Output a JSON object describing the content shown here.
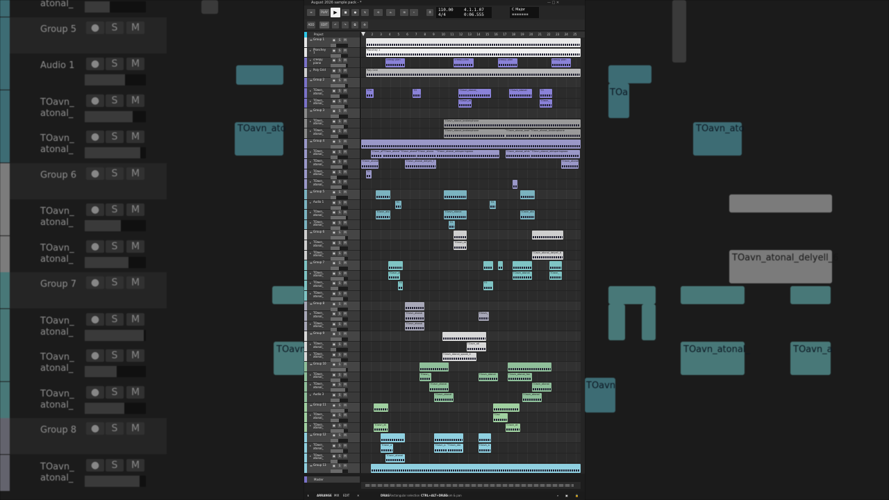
{
  "window": {
    "title": "August 2026 sample pack - *",
    "transport": {
      "tempo": "110.00",
      "time_signature": "4/4",
      "position_bars": "4.1.1.07",
      "position_time": "0:06.555",
      "key": "C Major",
      "play_label": "PLAY"
    },
    "toolbar": {
      "buttons": [
        "ADD",
        "EDIT"
      ]
    },
    "project_label": "Project",
    "ruler": [
      "1",
      "2",
      "3",
      "4",
      "5",
      "6",
      "7",
      "8",
      "9",
      "10",
      "11",
      "12",
      "13",
      "14",
      "15",
      "16",
      "17",
      "18",
      "19",
      "20",
      "21",
      "22",
      "23",
      "24",
      "25"
    ],
    "master_label": "Master",
    "status": {
      "tabs": [
        "ARRANGE",
        "MIX",
        "EDIT"
      ],
      "hint1_key": "DRAG",
      "hint1_text": "Rectangular selection",
      "hint2_key": "CTRL+ALT+DRAG",
      "hint2_text": "Zoom & pan"
    }
  },
  "tracks": [
    {
      "name": "Group 1",
      "kind": "group",
      "color": "#e6e6e6"
    },
    {
      "name": "Plonchey\n1",
      "kind": "track",
      "color": "#e6e6e6"
    },
    {
      "name": "creepy\npiano",
      "kind": "track",
      "color": "#7a72c8"
    },
    {
      "name": "Poly Grid",
      "kind": "track",
      "color": "#cfcfcf"
    },
    {
      "name": "Group 2",
      "kind": "group",
      "color": "#7a72c8"
    },
    {
      "name": "TOavn_\natonal_",
      "kind": "track",
      "color": "#7a72c8"
    },
    {
      "name": "TOavn_\natonal_",
      "kind": "track",
      "color": "#7a72c8"
    },
    {
      "name": "Group 3",
      "kind": "group",
      "color": "#8a8a8a"
    },
    {
      "name": "TOavn_\natonal_",
      "kind": "track",
      "color": "#8a8a8a"
    },
    {
      "name": "TOavn_\natonal_",
      "kind": "track",
      "color": "#8a8a8a"
    },
    {
      "name": "Group 4",
      "kind": "group",
      "color": "#9a98c8"
    },
    {
      "name": "TOavn_\natonal_",
      "kind": "track",
      "color": "#9a98c8"
    },
    {
      "name": "TOavn_\natonal_",
      "kind": "track",
      "color": "#9a98c8"
    },
    {
      "name": "TOavn_\natonal_",
      "kind": "track",
      "color": "#9a98c8"
    },
    {
      "name": "TOavn_\natonal_",
      "kind": "track",
      "color": "#9a98c8"
    },
    {
      "name": "Group 5",
      "kind": "group",
      "color": "#7bb3c0"
    },
    {
      "name": "Audio 1",
      "kind": "track",
      "color": "#7bb3c0"
    },
    {
      "name": "TOavn_\natonal_",
      "kind": "track",
      "color": "#7bb3c0"
    },
    {
      "name": "TOavn_\natonal_",
      "kind": "track",
      "color": "#7bb3c0"
    },
    {
      "name": "Group 6",
      "kind": "group",
      "color": "#cfcfcf"
    },
    {
      "name": "TOavn_\natonal_",
      "kind": "track",
      "color": "#cfcfcf"
    },
    {
      "name": "TOavn_\natonal_",
      "kind": "track",
      "color": "#cfcfcf"
    },
    {
      "name": "Group 7",
      "kind": "group",
      "color": "#7fc4c4"
    },
    {
      "name": "TOavn_\natonal_",
      "kind": "track",
      "color": "#7fc4c4"
    },
    {
      "name": "TOavn_\natonal_",
      "kind": "track",
      "color": "#7fc4c4"
    },
    {
      "name": "TOavn_\natonal_",
      "kind": "track",
      "color": "#7fc4c4"
    },
    {
      "name": "Group 8",
      "kind": "group",
      "color": "#a8a8b8"
    },
    {
      "name": "TOavn_\natonal_",
      "kind": "track",
      "color": "#a8a8b8"
    },
    {
      "name": "TOavn_\natonal_",
      "kind": "track",
      "color": "#a8a8b8"
    },
    {
      "name": "Group 9",
      "kind": "group",
      "color": "#d8d8d8"
    },
    {
      "name": "TOavn_\natonal_",
      "kind": "track",
      "color": "#d8d8d8"
    },
    {
      "name": "TOavn_\natonal_",
      "kind": "track",
      "color": "#d8d8d8"
    },
    {
      "name": "Group 10",
      "kind": "group",
      "color": "#8fbf9a"
    },
    {
      "name": "TOavn_\natonal_",
      "kind": "track",
      "color": "#8fbf9a"
    },
    {
      "name": "TOavn_\natonal_",
      "kind": "track",
      "color": "#8fbf9a"
    },
    {
      "name": "Audio 3",
      "kind": "track",
      "color": "#8fbf9a"
    },
    {
      "name": "Group 11",
      "kind": "group",
      "color": "#a0d0a0"
    },
    {
      "name": "TOavn_\natonal_",
      "kind": "track",
      "color": "#a0d0a0"
    },
    {
      "name": "TOavn_\natonal_",
      "kind": "track",
      "color": "#a0d0a0"
    },
    {
      "name": "Group 12",
      "kind": "group",
      "color": "#8fd0e0"
    },
    {
      "name": "TOavn_\natonal_",
      "kind": "track",
      "color": "#8fd0e0"
    },
    {
      "name": "TOavn_\natonal_",
      "kind": "track",
      "color": "#8fd0e0"
    },
    {
      "name": "Group 13",
      "kind": "group",
      "color": "#8fd0e0"
    }
  ],
  "clips": [
    {
      "lane": 0,
      "start": 0.5,
      "len": 22,
      "label": "",
      "color": "#e8e8e8"
    },
    {
      "lane": 1,
      "start": 0.5,
      "len": 22,
      "label": "Plonchey 1",
      "color": "#f0f0f0"
    },
    {
      "lane": 2,
      "start": 2.5,
      "len": 2,
      "label": "creepy plan",
      "color": "#8a82d8"
    },
    {
      "lane": 2,
      "start": 9.5,
      "len": 2,
      "label": "creepy plan",
      "color": "#8a82d8"
    },
    {
      "lane": 2,
      "start": 14,
      "len": 2,
      "label": "creepy plan",
      "color": "#8a82d8"
    },
    {
      "lane": 2,
      "start": 19.5,
      "len": 2,
      "label": "creepy plan",
      "color": "#8a82d8"
    },
    {
      "lane": 3,
      "start": 0.5,
      "len": 22,
      "label": "Poly Grid",
      "color": "#b8b8b8"
    },
    {
      "lane": 5,
      "start": 0.5,
      "len": 0.8,
      "label": "TOa",
      "color": "#8a82d8"
    },
    {
      "lane": 5,
      "start": 5.3,
      "len": 0.8,
      "label": "TO",
      "color": "#8a82d8"
    },
    {
      "lane": 5,
      "start": 10,
      "len": 3.3,
      "label": "TOavn_atonal_",
      "color": "#8a82d8"
    },
    {
      "lane": 5,
      "start": 15.2,
      "len": 2.3,
      "label": "TOavn_atonal",
      "color": "#8a82d8"
    },
    {
      "lane": 5,
      "start": 18.3,
      "len": 1.3,
      "label": "TO",
      "color": "#8a82d8"
    },
    {
      "lane": 6,
      "start": 10,
      "len": 1.3,
      "label": "TOavn_at",
      "color": "#8a82d8"
    },
    {
      "lane": 6,
      "start": 18.3,
      "len": 1.3,
      "label": "TOavn_",
      "color": "#8a82d8"
    },
    {
      "lane": 8,
      "start": 8.5,
      "len": 14,
      "label": "TOavn_atonal_brokenphone",
      "color": "#9a9a9a"
    },
    {
      "lane": 9,
      "start": 8.5,
      "len": 6.3,
      "label": "TOavn_atonal_brokenphone",
      "color": "#9a9a9a"
    },
    {
      "lane": 9,
      "start": 14.8,
      "len": 2.5,
      "label": "TOavn_atonal_brok",
      "color": "#9a9a9a"
    },
    {
      "lane": 9,
      "start": 17.3,
      "len": 5.2,
      "label": "TOavn_atonal_brokenphone",
      "color": "#9a9a9a"
    },
    {
      "lane": 10,
      "start": 0,
      "len": 22.5,
      "label": "",
      "color": "#9a98c8"
    },
    {
      "lane": 11,
      "start": 1,
      "len": 1.2,
      "label": "TOavn_at",
      "color": "#9a98c8"
    },
    {
      "lane": 11,
      "start": 2.2,
      "len": 1.8,
      "label": "TOavn_atona",
      "color": "#9a98c8"
    },
    {
      "lane": 11,
      "start": 4,
      "len": 1.7,
      "label": "TOavn_atona",
      "color": "#9a98c8"
    },
    {
      "lane": 11,
      "start": 5.7,
      "len": 2,
      "label": "TOavn_atona",
      "color": "#9a98c8"
    },
    {
      "lane": 11,
      "start": 7.7,
      "len": 6.5,
      "label": "TOavn_atonal_whisperingwoo",
      "color": "#9a98c8"
    },
    {
      "lane": 11,
      "start": 14.8,
      "len": 2.6,
      "label": "TOavn_atonal_whis",
      "color": "#9a98c8"
    },
    {
      "lane": 11,
      "start": 17.4,
      "len": 5,
      "label": "TOavn_atonal_whisperingwoo",
      "color": "#9a98c8"
    },
    {
      "lane": 12,
      "start": 0,
      "len": 1.8,
      "label": "TOavn_atonal",
      "color": "#9a98c8"
    },
    {
      "lane": 12,
      "start": 4.5,
      "len": 3.2,
      "label": "TOavn_atonal_delyell_7",
      "color": "#9a98c8"
    },
    {
      "lane": 12,
      "start": 20.5,
      "len": 1.8,
      "label": "TOavn_atonal",
      "color": "#9a98c8"
    },
    {
      "lane": 13,
      "start": 0.5,
      "len": 0.6,
      "label": "TO",
      "color": "#9a98c8"
    },
    {
      "lane": 14,
      "start": 15.5,
      "len": 0.5,
      "label": "",
      "color": "#9a98c8"
    },
    {
      "lane": 15,
      "start": 1.5,
      "len": 1.5,
      "label": "",
      "color": "#7bb3c0"
    },
    {
      "lane": 15,
      "start": 8.5,
      "len": 2.3,
      "label": "",
      "color": "#7bb3c0"
    },
    {
      "lane": 15,
      "start": 16.3,
      "len": 1.5,
      "label": "",
      "color": "#7bb3c0"
    },
    {
      "lane": 16,
      "start": 3.5,
      "len": 0.6,
      "label": "TO",
      "color": "#7bb3c0"
    },
    {
      "lane": 16,
      "start": 13.2,
      "len": 0.6,
      "label": "TO",
      "color": "#7bb3c0"
    },
    {
      "lane": 17,
      "start": 1.5,
      "len": 1.5,
      "label": "TOavn_ato",
      "color": "#7bb3c0"
    },
    {
      "lane": 17,
      "start": 8.5,
      "len": 2.3,
      "label": "TOavn_atonal",
      "color": "#7bb3c0"
    },
    {
      "lane": 17,
      "start": 16.3,
      "len": 1.5,
      "label": "TOavn_ato",
      "color": "#7bb3c0"
    },
    {
      "lane": 18,
      "start": 9,
      "len": 0.6,
      "label": "TO",
      "color": "#7bb3c0"
    },
    {
      "lane": 19,
      "start": 9.5,
      "len": 1.3,
      "label": "",
      "color": "#cfcfcf"
    },
    {
      "lane": 19,
      "start": 17.5,
      "len": 3.2,
      "label": "",
      "color": "#cfcfcf"
    },
    {
      "lane": 20,
      "start": 9.5,
      "len": 1.3,
      "label": "TOavn_at",
      "color": "#cfcfcf"
    },
    {
      "lane": 21,
      "start": 17.5,
      "len": 3.2,
      "label": "TOavn_atonal_delyell_6",
      "color": "#cfcfcf"
    },
    {
      "lane": 22,
      "start": 2.8,
      "len": 1.5,
      "label": "",
      "color": "#7fc4c4"
    },
    {
      "lane": 22,
      "start": 12.5,
      "len": 1,
      "label": "",
      "color": "#7fc4c4"
    },
    {
      "lane": 22,
      "start": 14,
      "len": 0.5,
      "label": "",
      "color": "#7fc4c4"
    },
    {
      "lane": 22,
      "start": 15.5,
      "len": 2,
      "label": "",
      "color": "#7fc4c4"
    },
    {
      "lane": 22,
      "start": 19.3,
      "len": 1.3,
      "label": "",
      "color": "#7fc4c4"
    },
    {
      "lane": 23,
      "start": 2.8,
      "len": 1.2,
      "label": "TOavn_at",
      "color": "#7fc4c4"
    },
    {
      "lane": 23,
      "start": 15.5,
      "len": 2,
      "label": "TOavn_atonal",
      "color": "#7fc4c4"
    },
    {
      "lane": 23,
      "start": 19.3,
      "len": 1.3,
      "label": "TOavn_",
      "color": "#7fc4c4"
    },
    {
      "lane": 24,
      "start": 3.8,
      "len": 0.5,
      "label": "TO",
      "color": "#7fc4c4"
    },
    {
      "lane": 24,
      "start": 12.5,
      "len": 1,
      "label": "TO",
      "color": "#7fc4c4"
    },
    {
      "lane": 26,
      "start": 4.5,
      "len": 2,
      "label": "",
      "color": "#a8a8b8"
    },
    {
      "lane": 27,
      "start": 4.5,
      "len": 2,
      "label": "TOavn_atonal",
      "color": "#a8a8b8"
    },
    {
      "lane": 27,
      "start": 12,
      "len": 1.1,
      "label": "TOavn_",
      "color": "#a8a8b8"
    },
    {
      "lane": 28,
      "start": 4.5,
      "len": 2,
      "label": "TOavn_atonal",
      "color": "#a8a8b8"
    },
    {
      "lane": 29,
      "start": 8.3,
      "len": 4.5,
      "label": "",
      "color": "#d8d8d8"
    },
    {
      "lane": 30,
      "start": 10.8,
      "len": 2,
      "label": "TOavn_atl",
      "color": "#d8d8d8"
    },
    {
      "lane": 31,
      "start": 8.3,
      "len": 3.5,
      "label": "TOavn_atonal_spook_4",
      "color": "#d8d8d8"
    },
    {
      "lane": 32,
      "start": 6,
      "len": 3,
      "label": "",
      "color": "#8fbf9a"
    },
    {
      "lane": 32,
      "start": 15,
      "len": 4.5,
      "label": "",
      "color": "#8fbf9a"
    },
    {
      "lane": 33,
      "start": 6,
      "len": 1.2,
      "label": "TOavn_",
      "color": "#8fbf9a"
    },
    {
      "lane": 33,
      "start": 12,
      "len": 2,
      "label": "TOavn_atonal",
      "color": "#8fbf9a"
    },
    {
      "lane": 33,
      "start": 15,
      "len": 2.5,
      "label": "TOavn_atonal_fan",
      "color": "#8fbf9a"
    },
    {
      "lane": 34,
      "start": 7,
      "len": 2,
      "label": "TOavn_atonal",
      "color": "#8fbf9a"
    },
    {
      "lane": 34,
      "start": 17.5,
      "len": 2,
      "label": "TOavn_atonal",
      "color": "#8fbf9a"
    },
    {
      "lane": 35,
      "start": 7.5,
      "len": 2,
      "label": "TOavn_atonal",
      "color": "#8fbf9a"
    },
    {
      "lane": 35,
      "start": 16.5,
      "len": 2,
      "label": "TOavn_atonal",
      "color": "#8fbf9a"
    },
    {
      "lane": 36,
      "start": 1.3,
      "len": 1.5,
      "label": "",
      "color": "#a0d0a0"
    },
    {
      "lane": 36,
      "start": 13.5,
      "len": 2.7,
      "label": "",
      "color": "#a0d0a0"
    },
    {
      "lane": 37,
      "start": 13.5,
      "len": 1.5,
      "label": "TOav",
      "color": "#a0d0a0"
    },
    {
      "lane": 38,
      "start": 1.3,
      "len": 1.5,
      "label": "TOavn_at",
      "color": "#a0d0a0"
    },
    {
      "lane": 38,
      "start": 14.8,
      "len": 1.5,
      "label": "TOavn_at",
      "color": "#a0d0a0"
    },
    {
      "lane": 39,
      "start": 2,
      "len": 2.5,
      "label": "",
      "color": "#8fd0e0"
    },
    {
      "lane": 39,
      "start": 7.5,
      "len": 3,
      "label": "",
      "color": "#8fd0e0"
    },
    {
      "lane": 39,
      "start": 12,
      "len": 1.3,
      "label": "",
      "color": "#8fd0e0"
    },
    {
      "lane": 40,
      "start": 2,
      "len": 1.3,
      "label": "TOavn_a",
      "color": "#8fd0e0"
    },
    {
      "lane": 40,
      "start": 7.5,
      "len": 1.3,
      "label": "TOavn_a",
      "color": "#8fd0e0"
    },
    {
      "lane": 40,
      "start": 8.8,
      "len": 1.7,
      "label": "TOavn_ato",
      "color": "#8fd0e0"
    },
    {
      "lane": 40,
      "start": 12,
      "len": 1.3,
      "label": "TOavn_a",
      "color": "#8fd0e0"
    },
    {
      "lane": 41,
      "start": 2.5,
      "len": 2,
      "label": "TOavn_atonal",
      "color": "#8fd0e0"
    },
    {
      "lane": 42,
      "start": 1,
      "len": 21.5,
      "label": "",
      "color": "#8fd0e0"
    }
  ],
  "background_left": {
    "rows": [
      {
        "name": "TOavn_\natonal_",
        "kind": "track",
        "color": "#5fa7b3"
      },
      {
        "name": "Group 5",
        "kind": "group",
        "color": "#5fa7b3"
      },
      {
        "name": "Audio 1",
        "kind": "track",
        "color": "#5fa7b3"
      },
      {
        "name": "TOavn_\natonal_",
        "kind": "track",
        "color": "#5fa7b3"
      },
      {
        "name": "TOavn_\natonal_",
        "kind": "track",
        "color": "#5fa7b3"
      },
      {
        "name": "Group 6",
        "kind": "group",
        "color": "#bfbfbf"
      },
      {
        "name": "TOavn_\natonal_",
        "kind": "track",
        "color": "#bfbfbf"
      },
      {
        "name": "TOavn_\natonal_",
        "kind": "track",
        "color": "#bfbfbf"
      },
      {
        "name": "Group 7",
        "kind": "group",
        "color": "#6fb9b9"
      },
      {
        "name": "TOavn_\natonal_",
        "kind": "track",
        "color": "#6fb9b9"
      },
      {
        "name": "TOavn_\natonal_",
        "kind": "track",
        "color": "#6fb9b9"
      },
      {
        "name": "TOavn_\natonal_",
        "kind": "track",
        "color": "#6fb9b9"
      },
      {
        "name": "Group 8",
        "kind": "group",
        "color": "#9898a8"
      },
      {
        "name": "TOavn_\natonal_",
        "kind": "track",
        "color": "#9898a8"
      }
    ]
  },
  "background_right": {
    "clips": [
      {
        "label": "TOavn_atonal_delyell_6",
        "color": "#bdbdbd"
      },
      {
        "label": "TOavn_atonal_",
        "color": "#6fb9b9"
      },
      {
        "label": "TOavn_a",
        "color": "#6fb9b9"
      },
      {
        "label": "TOa",
        "color": "#5fa7b3"
      },
      {
        "label": "TOavn_ato",
        "color": "#5fa7b3"
      },
      {
        "label": "TOavn",
        "color": "#5fa7b3"
      }
    ]
  }
}
